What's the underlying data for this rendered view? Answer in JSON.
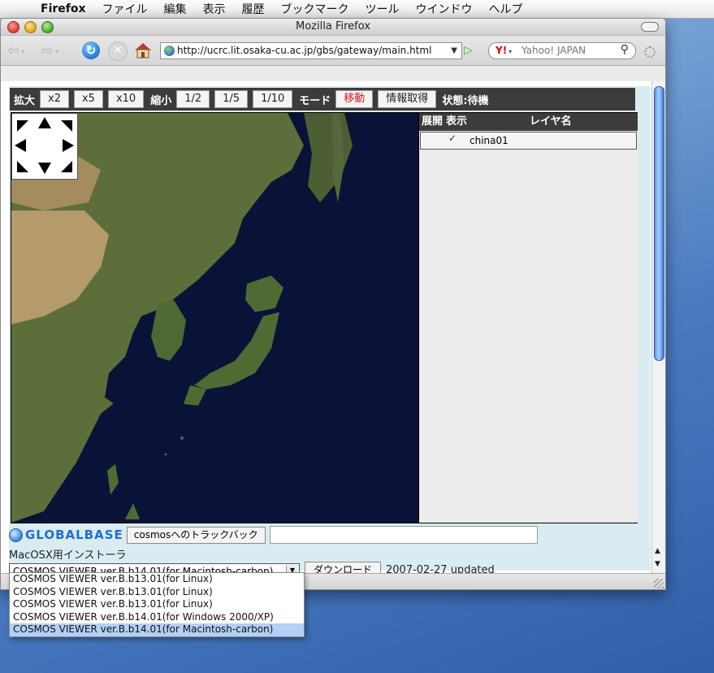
{
  "menubar": {
    "items": [
      "Firefox",
      "ファイル",
      "編集",
      "表示",
      "履歴",
      "ブックマーク",
      "ツール",
      "ウインドウ",
      "ヘルプ"
    ]
  },
  "window": {
    "title": "Mozilla Firefox"
  },
  "toolbar": {
    "url": "http://ucrc.lit.osaka-cu.ac.jp/gbs/gateway/main.html",
    "search_placeholder": "Yahoo! JAPAN",
    "search_engine": "Y!"
  },
  "mapbar": {
    "zoom_in_label": "拡大",
    "zoom_in_buttons": [
      "x2",
      "x5",
      "x10"
    ],
    "zoom_out_label": "縮小",
    "zoom_out_buttons": [
      "1/2",
      "1/5",
      "1/10"
    ],
    "mode_label": "モード",
    "mode_move": "移動",
    "info_button": "情報取得",
    "state": "状態:待機"
  },
  "layers": {
    "col_expand": "展開",
    "col_show": "表示",
    "col_name": "レイヤ名",
    "rows": [
      {
        "check": "✓",
        "name": "china01"
      }
    ]
  },
  "footer": {
    "logo": "GLOBALBASE",
    "trackback_button": "cosmosへのトラックバック",
    "installer_label": "MacOSX用インストーラ",
    "selected_option": "COSMOS VIEWER ver.B.b14.01(for Macintosh-carbon)",
    "download_button": "ダウンロード",
    "updated": "2007-02-27 updated"
  },
  "dropdown_options": [
    "COSMOS VIEWER ver.B.b13.01(for Linux)",
    "COSMOS VIEWER ver.B.b13.01(for Linux)",
    "COSMOS VIEWER ver.B.b13.01(for Linux)",
    "COSMOS VIEWER ver.B.b14.01(for Windows 2000/XP)",
    "COSMOS VIEWER ver.B.b14.01(for Macintosh-carbon)"
  ],
  "colors": {
    "accent_active": "#e01414",
    "select_highlight": "#b4d0f4",
    "bar": "#3c3c3c"
  }
}
